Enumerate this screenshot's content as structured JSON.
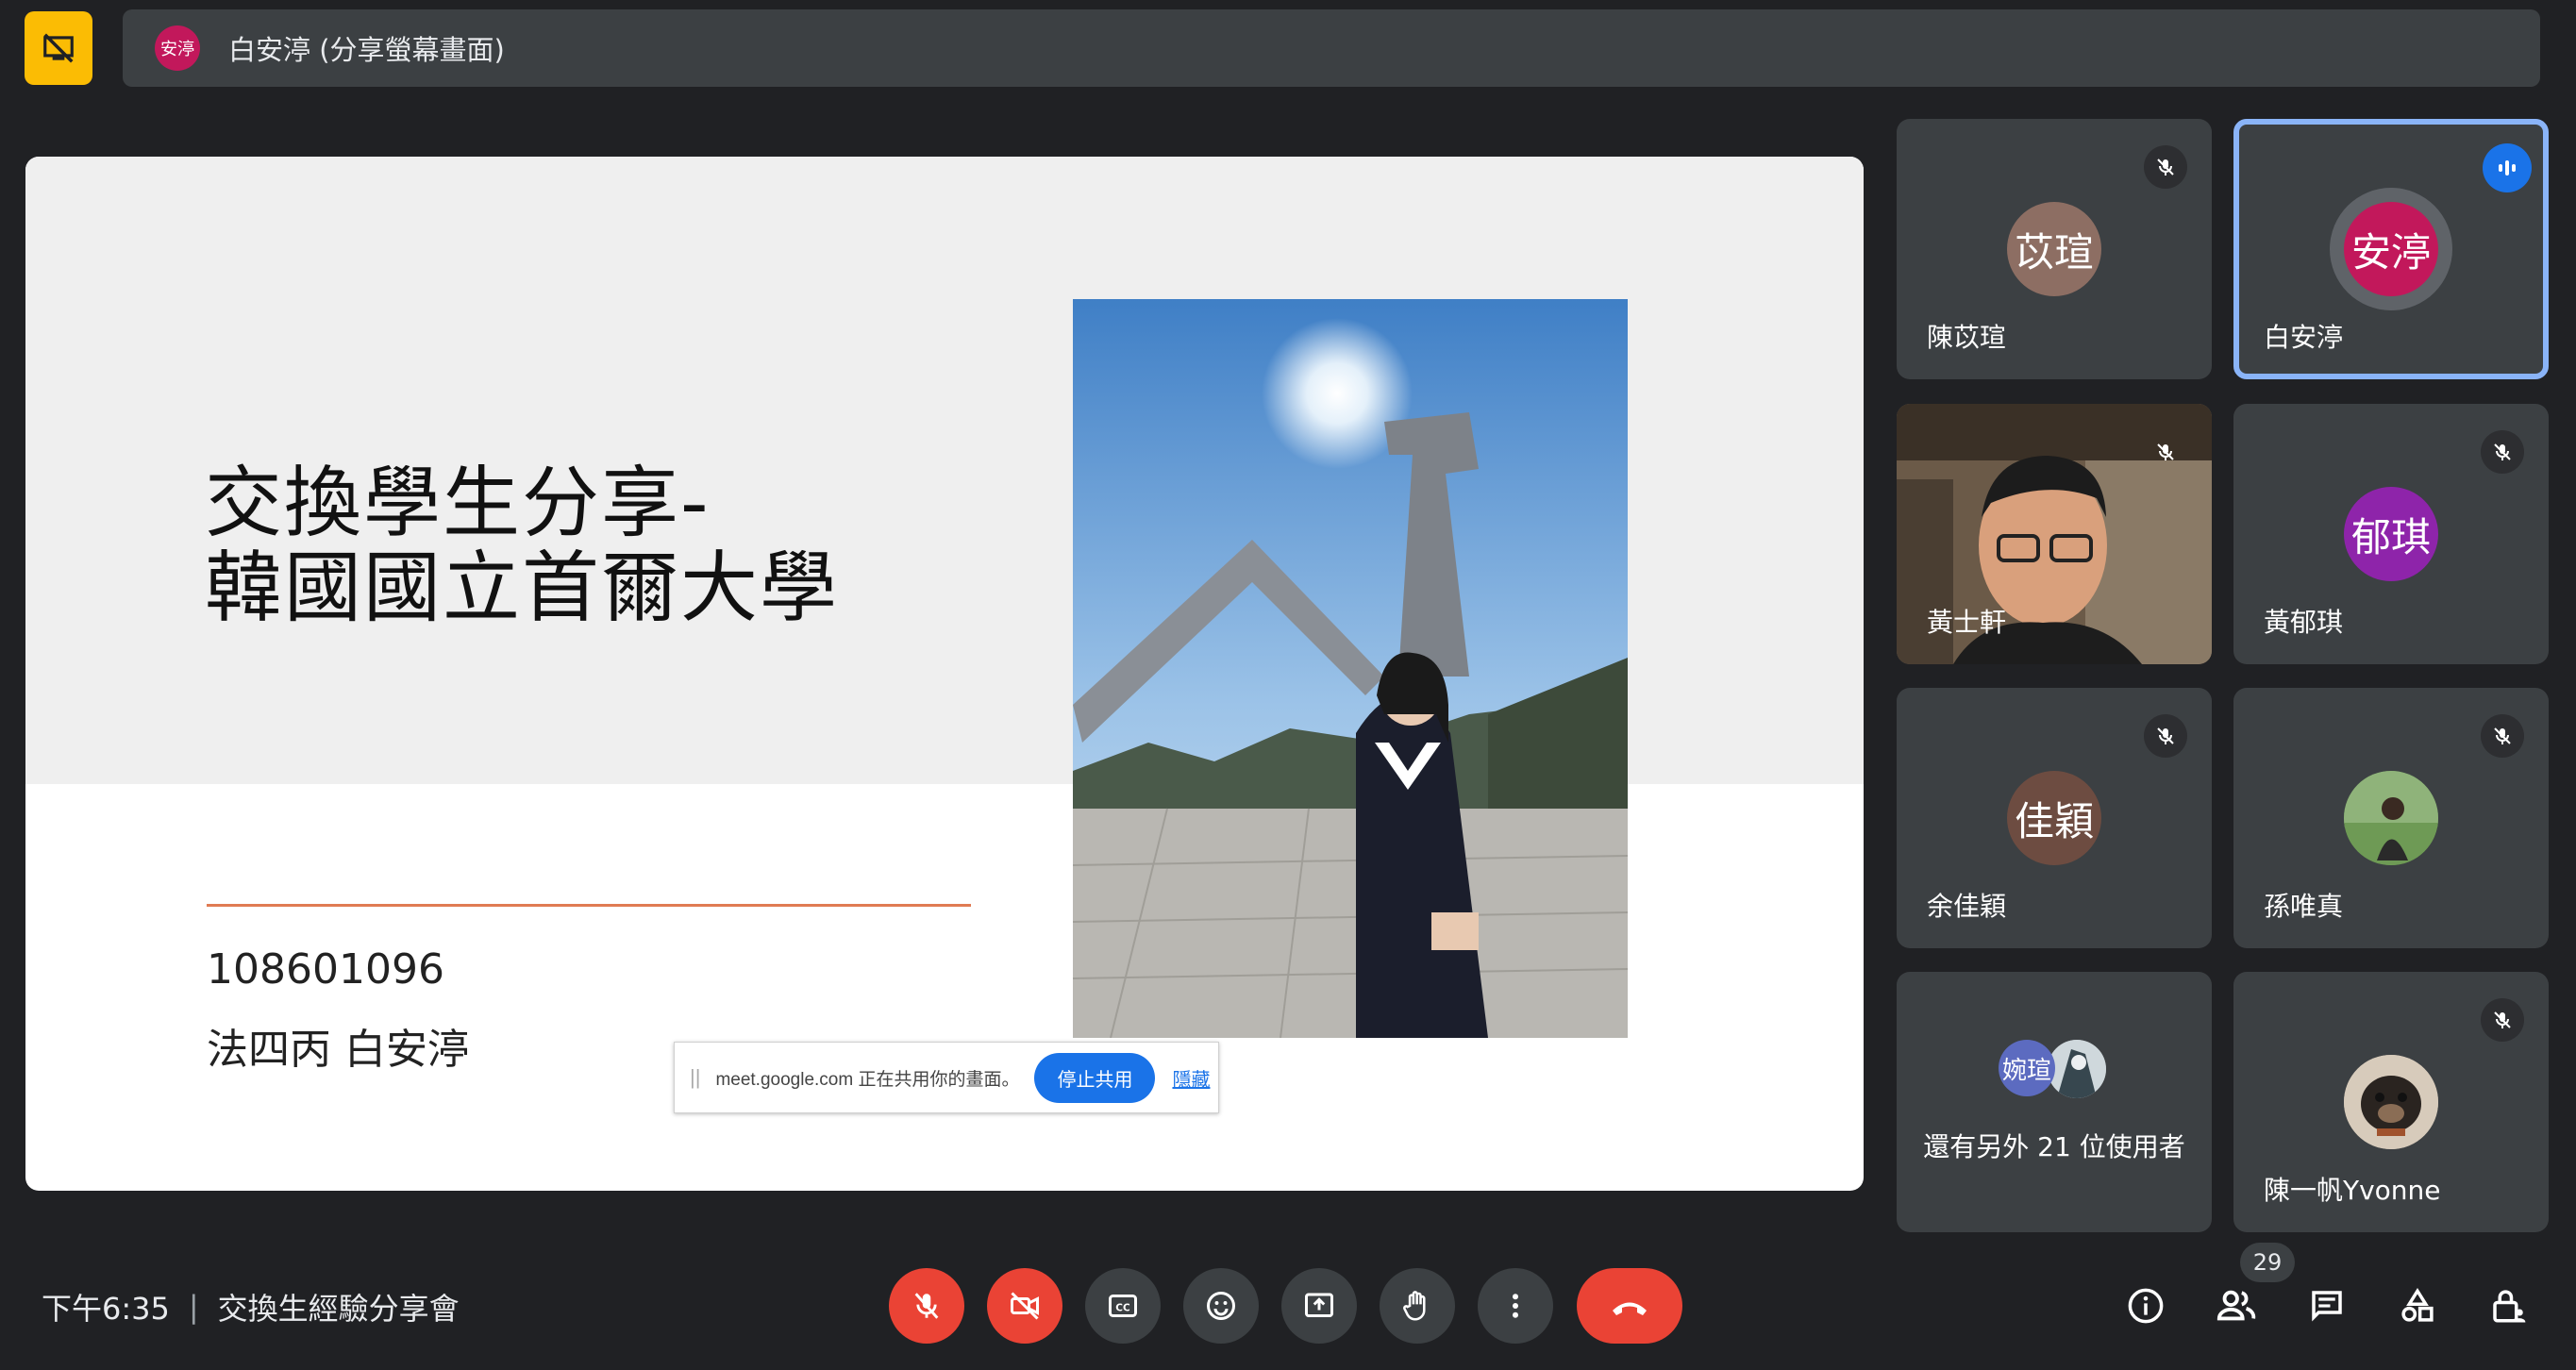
{
  "presenter_bar": {
    "avatar_text": "安渟",
    "label": "白安渟 (分享螢幕畫面)"
  },
  "slide": {
    "title_line1": "交換學生分享-",
    "title_line2": "韓國國立首爾大學",
    "student_id": "108601096",
    "student_name": "法四丙 白安渟"
  },
  "share_notice": {
    "text": "meet.google.com 正在共用你的畫面。",
    "stop_label": "停止共用",
    "hide_label": "隱藏"
  },
  "participants": [
    {
      "name": "陳苡瑄",
      "avatar": "苡瑄",
      "avatar_color": "#8d6e63",
      "muted": true
    },
    {
      "name": "白安渟",
      "avatar": "安渟",
      "avatar_color": "#c2185b",
      "speaking": true
    },
    {
      "name": "黃士軒",
      "video": true,
      "muted": true
    },
    {
      "name": "黃郁琪",
      "avatar": "郁琪",
      "avatar_color": "#8e24aa",
      "muted": true
    },
    {
      "name": "余佳穎",
      "avatar": "佳穎",
      "avatar_color": "#6d4c41",
      "muted": true
    },
    {
      "name": "孫唯真",
      "photo_avatar": true,
      "muted": true
    },
    {
      "name": "還有另外 21 位使用者",
      "avatar": "婉瑄",
      "avatar_color": "#5c6bc0"
    },
    {
      "name": "陳一帆Yvonne",
      "photo_avatar": true,
      "muted": true
    }
  ],
  "meeting": {
    "time": "下午6:35",
    "title": "交換生經驗分享會"
  },
  "people_count": "29",
  "colors": {
    "background": "#202124",
    "tile": "#3c4043",
    "accent_blue": "#1a73e8",
    "danger_red": "#ea4335",
    "present_yellow": "#fbbc04"
  }
}
